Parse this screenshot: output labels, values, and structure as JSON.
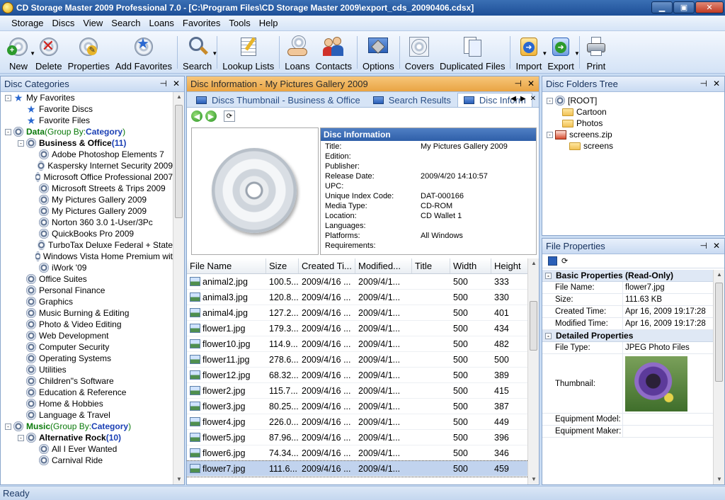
{
  "window": {
    "title": "CD Storage Master 2009 Professional 7.0 - [C:\\Program Files\\CD Storage Master 2009\\export_cds_20090406.cdsx]",
    "controls": [
      "minimize",
      "maximize",
      "close"
    ]
  },
  "menu": [
    "Storage",
    "Discs",
    "View",
    "Search",
    "Loans",
    "Favorites",
    "Tools",
    "Help"
  ],
  "toolbar": [
    {
      "label": "New",
      "icon": "new-disc-icon",
      "dropdown": true
    },
    {
      "label": "Delete",
      "icon": "delete-disc-icon"
    },
    {
      "label": "Properties",
      "icon": "properties-icon"
    },
    {
      "label": "Add Favorites",
      "icon": "add-favorites-icon"
    },
    {
      "label": "Search",
      "icon": "search-icon",
      "dropdown": true
    },
    {
      "label": "Lookup Lists",
      "icon": "lookup-lists-icon"
    },
    {
      "label": "Loans",
      "icon": "loans-icon"
    },
    {
      "label": "Contacts",
      "icon": "contacts-icon"
    },
    {
      "label": "Options",
      "icon": "options-icon"
    },
    {
      "label": "Covers",
      "icon": "covers-icon"
    },
    {
      "label": "Duplicated Files",
      "icon": "duplicated-files-icon"
    },
    {
      "label": "Import",
      "icon": "import-icon",
      "dropdown": true
    },
    {
      "label": "Export",
      "icon": "export-icon",
      "dropdown": true
    },
    {
      "label": "Print",
      "icon": "print-icon"
    }
  ],
  "disc_categories": {
    "title": "Disc Categories",
    "items": [
      {
        "level": 0,
        "exp": "-",
        "icon": "star",
        "text": "My Favorites"
      },
      {
        "level": 1,
        "exp": "",
        "icon": "star",
        "text": "Favorite Discs"
      },
      {
        "level": 1,
        "exp": "",
        "icon": "star",
        "text": "Favorite Files"
      },
      {
        "level": 0,
        "exp": "-",
        "icon": "disc",
        "text": "Data",
        "suffix": " (Group By: ",
        "link": "Category",
        "end": ")",
        "style": "data"
      },
      {
        "level": 1,
        "exp": "-",
        "icon": "disc",
        "text": "Business & Office",
        "count": " (11)",
        "style": "group"
      },
      {
        "level": 2,
        "exp": "",
        "icon": "disc",
        "text": "Adobe Photoshop Elements 7"
      },
      {
        "level": 2,
        "exp": "",
        "icon": "disc",
        "text": "Kaspersky Internet Security 2009"
      },
      {
        "level": 2,
        "exp": "",
        "icon": "disc",
        "text": "Microsoft Office Professional 2007"
      },
      {
        "level": 2,
        "exp": "",
        "icon": "disc",
        "text": "Microsoft Streets & Trips 2009"
      },
      {
        "level": 2,
        "exp": "",
        "icon": "disc",
        "text": "My Pictures Gallery 2009"
      },
      {
        "level": 2,
        "exp": "",
        "icon": "disc",
        "text": "My Pictures Gallery 2009"
      },
      {
        "level": 2,
        "exp": "",
        "icon": "disc",
        "text": "Norton 360 3.0 1-User/3Pc"
      },
      {
        "level": 2,
        "exp": "",
        "icon": "disc",
        "text": "QuickBooks Pro 2009"
      },
      {
        "level": 2,
        "exp": "",
        "icon": "disc",
        "text": "TurboTax Deluxe Federal + State"
      },
      {
        "level": 2,
        "exp": "",
        "icon": "disc",
        "text": "Windows Vista Home Premium wit"
      },
      {
        "level": 2,
        "exp": "",
        "icon": "disc",
        "text": "iWork '09"
      },
      {
        "level": 1,
        "exp": "",
        "icon": "disc",
        "text": "Office Suites"
      },
      {
        "level": 1,
        "exp": "",
        "icon": "disc",
        "text": "Personal Finance"
      },
      {
        "level": 1,
        "exp": "",
        "icon": "disc",
        "text": "Graphics"
      },
      {
        "level": 1,
        "exp": "",
        "icon": "disc",
        "text": "Music Burning & Editing"
      },
      {
        "level": 1,
        "exp": "",
        "icon": "disc",
        "text": "Photo & Video Editing"
      },
      {
        "level": 1,
        "exp": "",
        "icon": "disc",
        "text": "Web Development"
      },
      {
        "level": 1,
        "exp": "",
        "icon": "disc",
        "text": "Computer Security"
      },
      {
        "level": 1,
        "exp": "",
        "icon": "disc",
        "text": "Operating Systems"
      },
      {
        "level": 1,
        "exp": "",
        "icon": "disc",
        "text": "Utilities"
      },
      {
        "level": 1,
        "exp": "",
        "icon": "disc",
        "text": "Children\"s Software"
      },
      {
        "level": 1,
        "exp": "",
        "icon": "disc",
        "text": "Education & Reference"
      },
      {
        "level": 1,
        "exp": "",
        "icon": "disc",
        "text": "Home & Hobbies"
      },
      {
        "level": 1,
        "exp": "",
        "icon": "disc",
        "text": "Language & Travel"
      },
      {
        "level": 0,
        "exp": "-",
        "icon": "disc",
        "text": "Music",
        "suffix": " (Group By: ",
        "link": "Category",
        "end": ")",
        "style": "data"
      },
      {
        "level": 1,
        "exp": "-",
        "icon": "disc",
        "text": "Alternative Rock",
        "count": " (10)",
        "style": "group"
      },
      {
        "level": 2,
        "exp": "",
        "icon": "disc",
        "text": "All I Ever Wanted"
      },
      {
        "level": 2,
        "exp": "",
        "icon": "disc",
        "text": "Carnival Ride"
      }
    ]
  },
  "disc_info_panel": {
    "title": "Disc Information - My Pictures Gallery 2009",
    "tabs": [
      "Discs Thumbnail - Business & Office",
      "Search Results",
      "Disc Inform"
    ],
    "info_title": "Disc Information",
    "fields": [
      {
        "label": "Title:",
        "value": "My Pictures Gallery 2009"
      },
      {
        "label": "Edition:",
        "value": ""
      },
      {
        "label": "Publisher:",
        "value": ""
      },
      {
        "label": "Release Date:",
        "value": "2009/4/20 14:10:57"
      },
      {
        "label": "UPC:",
        "value": ""
      },
      {
        "label": "Unique Index Code:",
        "value": "DAT-000166"
      },
      {
        "label": "Media Type:",
        "value": "CD-ROM"
      },
      {
        "label": "Location:",
        "value": "CD Wallet 1"
      },
      {
        "label": "Languages:",
        "value": ""
      },
      {
        "label": "Platforms:",
        "value": "All Windows"
      },
      {
        "label": "Requirements:",
        "value": ""
      }
    ],
    "columns": [
      "File Name",
      "Size",
      "Created Ti...",
      "Modified...",
      "Title",
      "Width",
      "Height"
    ],
    "files": [
      [
        "animal2.jpg",
        "100.5...",
        "2009/4/16 ...",
        "2009/4/1...",
        "",
        "500",
        "333"
      ],
      [
        "animal3.jpg",
        "120.8...",
        "2009/4/16 ...",
        "2009/4/1...",
        "",
        "500",
        "330"
      ],
      [
        "animal4.jpg",
        "127.2...",
        "2009/4/16 ...",
        "2009/4/1...",
        "",
        "500",
        "401"
      ],
      [
        "flower1.jpg",
        "179.3...",
        "2009/4/16 ...",
        "2009/4/1...",
        "",
        "500",
        "434"
      ],
      [
        "flower10.jpg",
        "114.9...",
        "2009/4/16 ...",
        "2009/4/1...",
        "",
        "500",
        "482"
      ],
      [
        "flower11.jpg",
        "278.6...",
        "2009/4/16 ...",
        "2009/4/1...",
        "",
        "500",
        "500"
      ],
      [
        "flower12.jpg",
        "68.32...",
        "2009/4/16 ...",
        "2009/4/1...",
        "",
        "500",
        "389"
      ],
      [
        "flower2.jpg",
        "115.7...",
        "2009/4/16 ...",
        "2009/4/1...",
        "",
        "500",
        "415"
      ],
      [
        "flower3.jpg",
        "80.25...",
        "2009/4/16 ...",
        "2009/4/1...",
        "",
        "500",
        "387"
      ],
      [
        "flower4.jpg",
        "226.0...",
        "2009/4/16 ...",
        "2009/4/1...",
        "",
        "500",
        "449"
      ],
      [
        "flower5.jpg",
        "87.96...",
        "2009/4/16 ...",
        "2009/4/1...",
        "",
        "500",
        "396"
      ],
      [
        "flower6.jpg",
        "74.34...",
        "2009/4/16 ...",
        "2009/4/1...",
        "",
        "500",
        "346"
      ],
      [
        "flower7.jpg",
        "111.6...",
        "2009/4/16 ...",
        "2009/4/1...",
        "",
        "500",
        "459"
      ]
    ],
    "selected_file": "flower7.jpg"
  },
  "folders_tree": {
    "title": "Disc Folders Tree",
    "items": [
      {
        "level": 0,
        "exp": "-",
        "icon": "disc",
        "text": "[ROOT]"
      },
      {
        "level": 1,
        "exp": "",
        "icon": "folder",
        "text": "Cartoon"
      },
      {
        "level": 1,
        "exp": "",
        "icon": "folder",
        "text": "Photos"
      },
      {
        "level": 0,
        "exp": "-",
        "icon": "zip",
        "text": "screens.zip"
      },
      {
        "level": 2,
        "exp": "",
        "icon": "folder",
        "text": "screens"
      }
    ]
  },
  "file_properties": {
    "title": "File Properties",
    "basic_title": "Basic Properties (Read-Only)",
    "basic": [
      {
        "label": "File Name:",
        "value": "flower7.jpg"
      },
      {
        "label": "Size:",
        "value": "111.63 KB"
      },
      {
        "label": "Created Time:",
        "value": "Apr 16, 2009 19:17:28"
      },
      {
        "label": "Modified Time:",
        "value": "Apr 16, 2009 19:17:28"
      }
    ],
    "detailed_title": "Detailed Properties",
    "detailed": [
      {
        "label": "File Type:",
        "value": "JPEG Photo Files"
      },
      {
        "label": "Thumbnail:",
        "value": ""
      },
      {
        "label": "Equipment Model:",
        "value": ""
      },
      {
        "label": "Equipment Maker:",
        "value": ""
      }
    ]
  },
  "status": "Ready",
  "colors": {
    "accent": "#1d4f97",
    "panel_header": "#c9dbf2",
    "selection": "#c1d3ee",
    "group_green": "#0a7a0a"
  }
}
